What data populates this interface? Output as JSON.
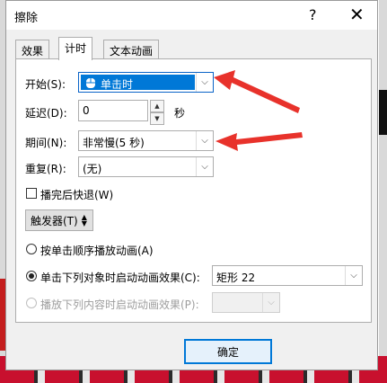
{
  "dialog": {
    "title": "擦除",
    "help_glyph": "?",
    "close_glyph": "✕",
    "tabs": [
      {
        "label": "效果",
        "active": false
      },
      {
        "label": "计时",
        "active": true
      },
      {
        "label": "文本动画",
        "active": false
      }
    ],
    "start": {
      "label": "开始(S):",
      "value": "单击时",
      "icon": "mouse-icon"
    },
    "delay": {
      "label": "延迟(D):",
      "value": "0",
      "unit": "秒"
    },
    "duration": {
      "label": "期间(N):",
      "value": "非常慢(5 秒)"
    },
    "repeat": {
      "label": "重复(R):",
      "value": "(无)"
    },
    "rewind": {
      "label": "播完后快退(W)",
      "checked": false
    },
    "triggers": {
      "label": "触发器(T)",
      "icon": "collapse-toggle-icon"
    },
    "options": [
      {
        "label": "按单击顺序播放动画(A)",
        "selected": false,
        "enabled": true
      },
      {
        "label": "单击下列对象时启动动画效果(C):",
        "selected": true,
        "enabled": true,
        "object": "矩形 22"
      },
      {
        "label": "播放下列内容时启动动画效果(P):",
        "selected": false,
        "enabled": false,
        "object": ""
      }
    ],
    "ok_label": "确定"
  },
  "colors": {
    "annotation_arrow": "#e8322b",
    "selection": "#0078d7"
  }
}
